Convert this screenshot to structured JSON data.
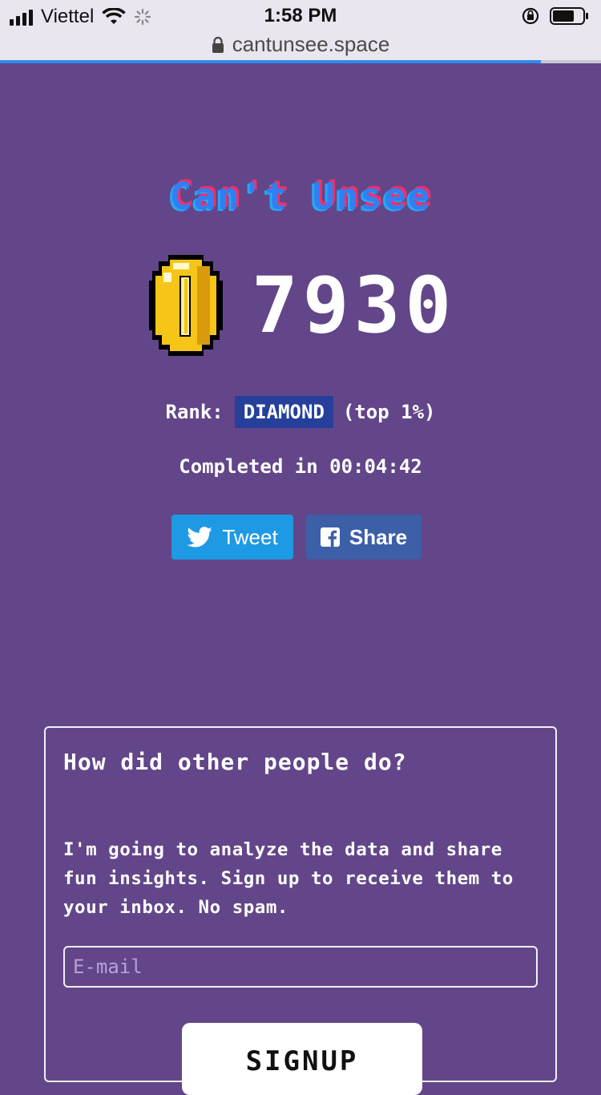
{
  "status_bar": {
    "carrier": "Viettel",
    "time": "1:58 PM",
    "signal_bars": 4
  },
  "browser": {
    "url": "cantunsee.space",
    "load_progress": 0.9,
    "accent": "#2f8bea"
  },
  "game": {
    "title": "Can't Unsee",
    "score": "7930",
    "rank_label": "Rank:",
    "rank": "DIAMOND",
    "rank_note": "(top 1%)",
    "completed": "Completed in 00:04:42"
  },
  "share": {
    "tweet_label": "Tweet",
    "share_label": "Share"
  },
  "signup": {
    "heading": "How did other people do?",
    "body": "I'm going to analyze the data and share fun insights. Sign up to receive them to your inbox. No spam.",
    "email_placeholder": "E-mail",
    "email_value": "",
    "button_label": "SIGNUP"
  },
  "colors": {
    "background": "#634689",
    "rank_badge": "#253f9b",
    "tweet": "#1e9ae4",
    "facebook": "#3c5fa8"
  }
}
